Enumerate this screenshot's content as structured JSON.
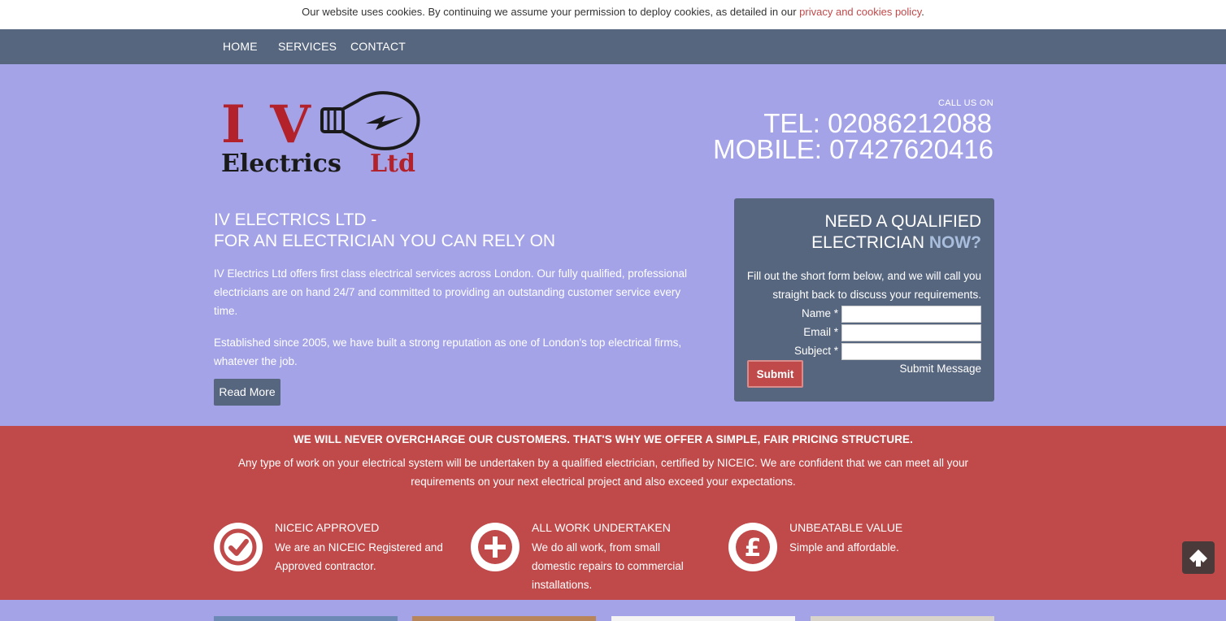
{
  "cookie": {
    "text": "Our website uses cookies. By continuing we assume your permission to deploy cookies, as detailed in our ",
    "link": "privacy and cookies policy",
    "end": "."
  },
  "nav": {
    "items": [
      "HOME",
      "SERVICES",
      "CONTACT"
    ]
  },
  "logo": {
    "line1": "I V",
    "line2": "Electrics",
    "line3": "Ltd"
  },
  "contact": {
    "call_us": "CALL US ON",
    "tel": "TEL: 02086212088",
    "mobile": "MOBILE: 07427620416"
  },
  "hero": {
    "title_line1": "IV ELECTRICS LTD -",
    "title_line2": "FOR AN ELECTRICIAN YOU CAN RELY ON",
    "p1": "IV Electrics Ltd offers first class electrical services across London. Our fully qualified, professional electricians are on hand 24/7 and committed to providing an outstanding customer service every time.",
    "p2": "Established since 2005, we have built a strong reputation as one of London's top electrical firms, whatever the job.",
    "read_more": "Read More"
  },
  "form": {
    "title_line1": "NEED A QUALIFIED",
    "title_line2": "ELECTRICIAN ",
    "title_now": "NOW?",
    "desc": "Fill out the short form below, and we will call you straight back to discuss your requirements.",
    "name_label": "Name *",
    "email_label": "Email *",
    "subject_label": "Subject *",
    "submit": "Submit",
    "submit_message": "Submit Message"
  },
  "band": {
    "heading": "WE WILL NEVER OVERCHARGE OUR CUSTOMERS. THAT'S WHY WE OFFER A SIMPLE, FAIR PRICING STRUCTURE.",
    "text": "Any type of work on your electrical system will be undertaken by a qualified electrician, certified by NICEIC. We are confident that we can meet all your requirements on your next electrical project and also exceed your expectations."
  },
  "features": [
    {
      "title": "NICEIC APPROVED",
      "text": "We are an NICEIC Registered and Approved contractor.",
      "icon": "check-circle-icon"
    },
    {
      "title": "ALL WORK UNDERTAKEN",
      "text": "We do all work, from small domestic repairs to commercial installations.",
      "icon": "plus-circle-icon"
    },
    {
      "title": "UNBEATABLE VALUE",
      "text": "Simple and affordable.",
      "icon": "pound-circle-icon"
    }
  ],
  "colors": {
    "background": "#a4a3e7",
    "nav": "#57667f",
    "accent_red": "#c0494a",
    "logo_red": "#b3222a",
    "now_blue": "#a9bedc"
  }
}
